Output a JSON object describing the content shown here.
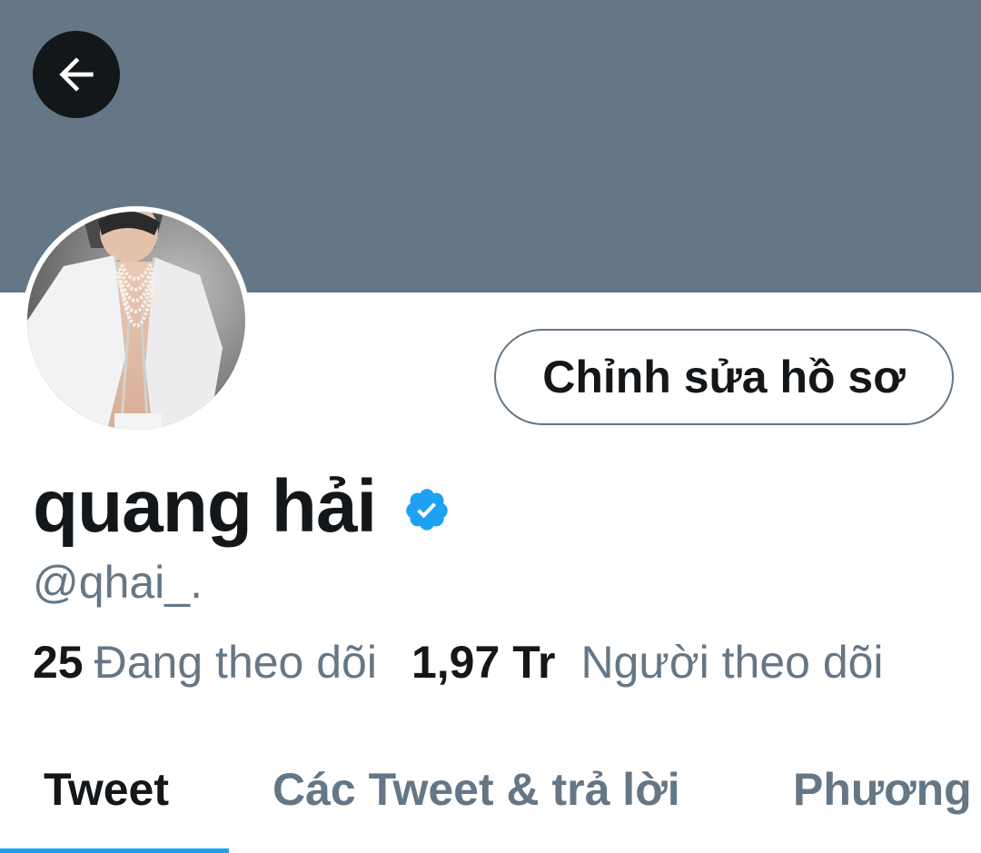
{
  "header": {
    "back_label": "Back",
    "banner_color": "#657786"
  },
  "profile": {
    "name": "quang hải",
    "handle": "@qhai_.",
    "verified": true,
    "edit_button_label": "Chỉnh sửa hồ sơ"
  },
  "stats": {
    "following_count": "25",
    "following_label": "Đang theo dõi",
    "followers_count": "1,97 Tr",
    "followers_label": "Người theo dõi"
  },
  "tabs": [
    {
      "label": "Tweet",
      "active": true
    },
    {
      "label": "Các Tweet & trả lời",
      "active": false
    },
    {
      "label": "Phương",
      "active": false
    }
  ],
  "colors": {
    "accent": "#1da1f2",
    "text_primary": "#14171a",
    "text_secondary": "#657786"
  }
}
